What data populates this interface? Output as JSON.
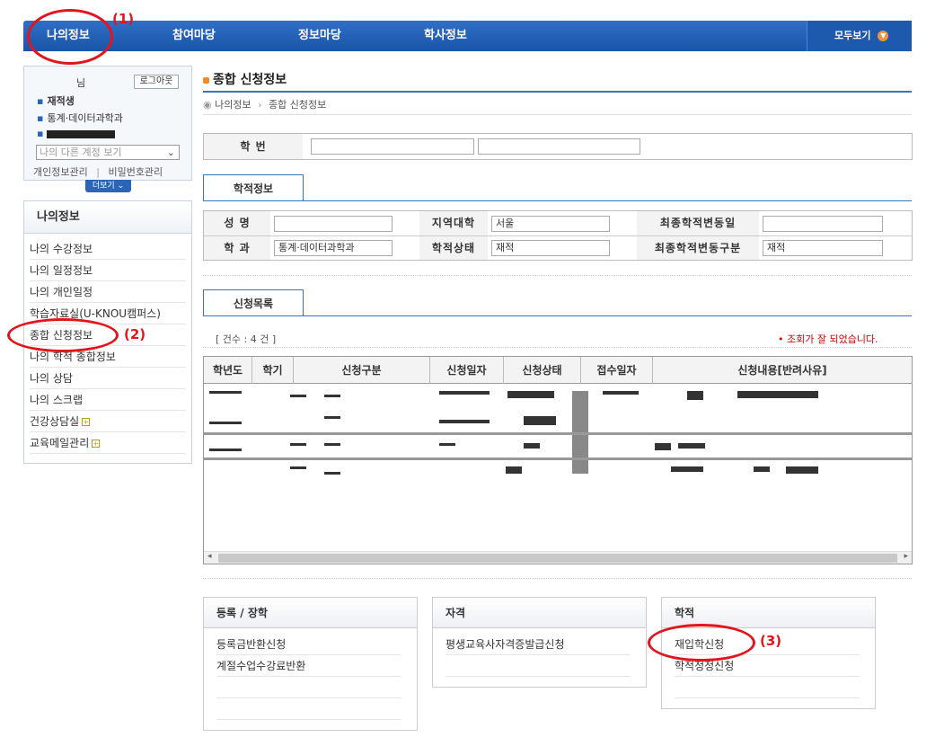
{
  "nav": {
    "items": [
      "나의정보",
      "참여마당",
      "정보마당",
      "학사정보"
    ],
    "all_label": "모두보기"
  },
  "user": {
    "name_suffix": "님",
    "logout": "로그아웃",
    "status": "재적생",
    "dept": "통계·데이터과학과",
    "account_select_placeholder": "나의 다른 계정 보기",
    "link_personal": "개인정보관리",
    "link_password": "비밀번호관리",
    "more": "더보기"
  },
  "sidebar": {
    "title": "나의정보",
    "items": [
      "나의 수강정보",
      "나의 일정정보",
      "나의 개인일정",
      "학습자료실(U-KNOU캠퍼스)",
      "종합 신청정보",
      "나의 학적 종합정보",
      "나의 상담",
      "나의 스크랩",
      "건강상담실",
      "교육메일관리"
    ]
  },
  "page": {
    "title": "종합 신청정보",
    "breadcrumb": [
      "나의정보",
      "종합 신청정보"
    ]
  },
  "student_no": {
    "label": "학    번"
  },
  "tabs": {
    "academic": "학적정보",
    "applications": "신청목록"
  },
  "academic": {
    "name_label": "성    명",
    "dept_label": "학    과",
    "dept_value": "통계·데이터과학과",
    "region_label": "지역대학",
    "region_value": "서울",
    "status_label": "학적상태",
    "status_value": "재적",
    "last_change_date_label": "최종학적변동일",
    "last_change_type_label": "최종학적변동구분",
    "last_change_type_value": "재적"
  },
  "list": {
    "count": "[ 건수 : 4 건 ]",
    "notice": "• 조회가 잘 되었습니다.",
    "columns": [
      "학년도",
      "학기",
      "신청구분",
      "신청일자",
      "신청상태",
      "접수일자",
      "신청내용[반려사유]"
    ]
  },
  "panels": [
    {
      "title": "등록 / 장학",
      "links": [
        "등록금반환신청",
        "계절수업수강료반환"
      ]
    },
    {
      "title": "자격",
      "links": [
        "평생교육사자격증발급신청"
      ]
    },
    {
      "title": "학적",
      "links": [
        "재입학신청",
        "학적정정신청"
      ]
    }
  ],
  "annotations": [
    "(1)",
    "(2)",
    "(3)"
  ],
  "colors": {
    "nav": "#1a55a8",
    "accent": "#3b73c0",
    "annotation": "#e3141c",
    "bullet": "#f08a24"
  }
}
